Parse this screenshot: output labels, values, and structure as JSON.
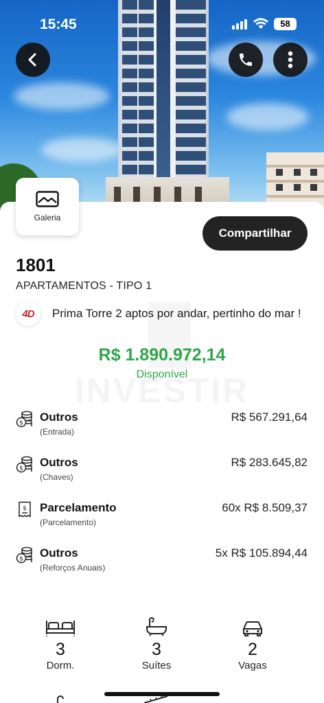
{
  "status_bar": {
    "time": "15:45",
    "battery": "58"
  },
  "hero": {
    "gallery_label": "Galeria"
  },
  "actions": {
    "share_label": "Compartilhar"
  },
  "unit": {
    "number": "1801",
    "type": "APARTAMENTOS - TIPO 1",
    "developer_logo_text": "4D",
    "description": "Prima Torre 2 aptos por andar, pertinho do mar !"
  },
  "watermark": "INVESTIR",
  "price": {
    "value": "R$ 1.890.972,14",
    "status": "Disponível"
  },
  "payments": [
    {
      "icon": "coins-icon",
      "title": "Outros",
      "subtitle": "(Entrada)",
      "value": "R$ 567.291,64"
    },
    {
      "icon": "coins-icon",
      "title": "Outros",
      "subtitle": "(Chaves)",
      "value": "R$ 283.645,82"
    },
    {
      "icon": "receipt-icon",
      "title": "Parcelamento",
      "subtitle": "(Parcelamento)",
      "value": "60x  R$ 8.509,37"
    },
    {
      "icon": "coins-icon",
      "title": "Outros",
      "subtitle": "(Reforços Anuais)",
      "value": "5x  R$ 105.894,44"
    }
  ],
  "features": [
    {
      "icon": "bed-icon",
      "count": "3",
      "label": "Dorm."
    },
    {
      "icon": "bathtub-icon",
      "count": "3",
      "label": "Suítes"
    },
    {
      "icon": "car-icon",
      "count": "2",
      "label": "Vagas"
    }
  ],
  "colors": {
    "accent_green": "#2ea64a",
    "dark_button": "#232323"
  }
}
